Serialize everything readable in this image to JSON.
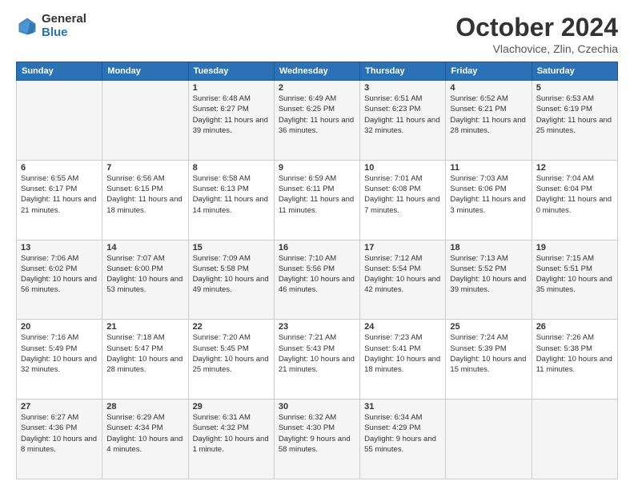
{
  "header": {
    "logo_general": "General",
    "logo_blue": "Blue",
    "month_title": "October 2024",
    "location": "Vlachovice, Zlin, Czechia"
  },
  "days_of_week": [
    "Sunday",
    "Monday",
    "Tuesday",
    "Wednesday",
    "Thursday",
    "Friday",
    "Saturday"
  ],
  "weeks": [
    [
      {
        "day": "",
        "sunrise": "",
        "sunset": "",
        "daylight": ""
      },
      {
        "day": "",
        "sunrise": "",
        "sunset": "",
        "daylight": ""
      },
      {
        "day": "1",
        "sunrise": "Sunrise: 6:48 AM",
        "sunset": "Sunset: 6:27 PM",
        "daylight": "Daylight: 11 hours and 39 minutes."
      },
      {
        "day": "2",
        "sunrise": "Sunrise: 6:49 AM",
        "sunset": "Sunset: 6:25 PM",
        "daylight": "Daylight: 11 hours and 36 minutes."
      },
      {
        "day": "3",
        "sunrise": "Sunrise: 6:51 AM",
        "sunset": "Sunset: 6:23 PM",
        "daylight": "Daylight: 11 hours and 32 minutes."
      },
      {
        "day": "4",
        "sunrise": "Sunrise: 6:52 AM",
        "sunset": "Sunset: 6:21 PM",
        "daylight": "Daylight: 11 hours and 28 minutes."
      },
      {
        "day": "5",
        "sunrise": "Sunrise: 6:53 AM",
        "sunset": "Sunset: 6:19 PM",
        "daylight": "Daylight: 11 hours and 25 minutes."
      }
    ],
    [
      {
        "day": "6",
        "sunrise": "Sunrise: 6:55 AM",
        "sunset": "Sunset: 6:17 PM",
        "daylight": "Daylight: 11 hours and 21 minutes."
      },
      {
        "day": "7",
        "sunrise": "Sunrise: 6:56 AM",
        "sunset": "Sunset: 6:15 PM",
        "daylight": "Daylight: 11 hours and 18 minutes."
      },
      {
        "day": "8",
        "sunrise": "Sunrise: 6:58 AM",
        "sunset": "Sunset: 6:13 PM",
        "daylight": "Daylight: 11 hours and 14 minutes."
      },
      {
        "day": "9",
        "sunrise": "Sunrise: 6:59 AM",
        "sunset": "Sunset: 6:11 PM",
        "daylight": "Daylight: 11 hours and 11 minutes."
      },
      {
        "day": "10",
        "sunrise": "Sunrise: 7:01 AM",
        "sunset": "Sunset: 6:08 PM",
        "daylight": "Daylight: 11 hours and 7 minutes."
      },
      {
        "day": "11",
        "sunrise": "Sunrise: 7:03 AM",
        "sunset": "Sunset: 6:06 PM",
        "daylight": "Daylight: 11 hours and 3 minutes."
      },
      {
        "day": "12",
        "sunrise": "Sunrise: 7:04 AM",
        "sunset": "Sunset: 6:04 PM",
        "daylight": "Daylight: 11 hours and 0 minutes."
      }
    ],
    [
      {
        "day": "13",
        "sunrise": "Sunrise: 7:06 AM",
        "sunset": "Sunset: 6:02 PM",
        "daylight": "Daylight: 10 hours and 56 minutes."
      },
      {
        "day": "14",
        "sunrise": "Sunrise: 7:07 AM",
        "sunset": "Sunset: 6:00 PM",
        "daylight": "Daylight: 10 hours and 53 minutes."
      },
      {
        "day": "15",
        "sunrise": "Sunrise: 7:09 AM",
        "sunset": "Sunset: 5:58 PM",
        "daylight": "Daylight: 10 hours and 49 minutes."
      },
      {
        "day": "16",
        "sunrise": "Sunrise: 7:10 AM",
        "sunset": "Sunset: 5:56 PM",
        "daylight": "Daylight: 10 hours and 46 minutes."
      },
      {
        "day": "17",
        "sunrise": "Sunrise: 7:12 AM",
        "sunset": "Sunset: 5:54 PM",
        "daylight": "Daylight: 10 hours and 42 minutes."
      },
      {
        "day": "18",
        "sunrise": "Sunrise: 7:13 AM",
        "sunset": "Sunset: 5:52 PM",
        "daylight": "Daylight: 10 hours and 39 minutes."
      },
      {
        "day": "19",
        "sunrise": "Sunrise: 7:15 AM",
        "sunset": "Sunset: 5:51 PM",
        "daylight": "Daylight: 10 hours and 35 minutes."
      }
    ],
    [
      {
        "day": "20",
        "sunrise": "Sunrise: 7:16 AM",
        "sunset": "Sunset: 5:49 PM",
        "daylight": "Daylight: 10 hours and 32 minutes."
      },
      {
        "day": "21",
        "sunrise": "Sunrise: 7:18 AM",
        "sunset": "Sunset: 5:47 PM",
        "daylight": "Daylight: 10 hours and 28 minutes."
      },
      {
        "day": "22",
        "sunrise": "Sunrise: 7:20 AM",
        "sunset": "Sunset: 5:45 PM",
        "daylight": "Daylight: 10 hours and 25 minutes."
      },
      {
        "day": "23",
        "sunrise": "Sunrise: 7:21 AM",
        "sunset": "Sunset: 5:43 PM",
        "daylight": "Daylight: 10 hours and 21 minutes."
      },
      {
        "day": "24",
        "sunrise": "Sunrise: 7:23 AM",
        "sunset": "Sunset: 5:41 PM",
        "daylight": "Daylight: 10 hours and 18 minutes."
      },
      {
        "day": "25",
        "sunrise": "Sunrise: 7:24 AM",
        "sunset": "Sunset: 5:39 PM",
        "daylight": "Daylight: 10 hours and 15 minutes."
      },
      {
        "day": "26",
        "sunrise": "Sunrise: 7:26 AM",
        "sunset": "Sunset: 5:38 PM",
        "daylight": "Daylight: 10 hours and 11 minutes."
      }
    ],
    [
      {
        "day": "27",
        "sunrise": "Sunrise: 6:27 AM",
        "sunset": "Sunset: 4:36 PM",
        "daylight": "Daylight: 10 hours and 8 minutes."
      },
      {
        "day": "28",
        "sunrise": "Sunrise: 6:29 AM",
        "sunset": "Sunset: 4:34 PM",
        "daylight": "Daylight: 10 hours and 4 minutes."
      },
      {
        "day": "29",
        "sunrise": "Sunrise: 6:31 AM",
        "sunset": "Sunset: 4:32 PM",
        "daylight": "Daylight: 10 hours and 1 minute."
      },
      {
        "day": "30",
        "sunrise": "Sunrise: 6:32 AM",
        "sunset": "Sunset: 4:30 PM",
        "daylight": "Daylight: 9 hours and 58 minutes."
      },
      {
        "day": "31",
        "sunrise": "Sunrise: 6:34 AM",
        "sunset": "Sunset: 4:29 PM",
        "daylight": "Daylight: 9 hours and 55 minutes."
      },
      {
        "day": "",
        "sunrise": "",
        "sunset": "",
        "daylight": ""
      },
      {
        "day": "",
        "sunrise": "",
        "sunset": "",
        "daylight": ""
      }
    ]
  ]
}
